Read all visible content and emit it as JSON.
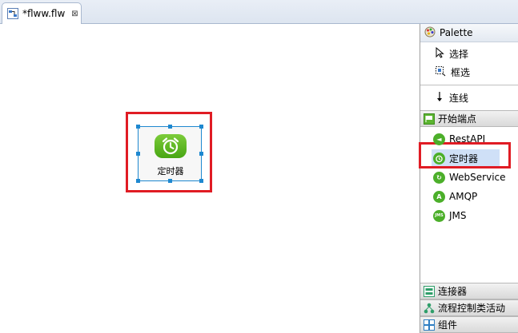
{
  "editor_tab": {
    "label": "*flww.flw",
    "close_glyph": "⊠"
  },
  "node": {
    "label": "定时器",
    "icon": "alarm-clock-icon"
  },
  "palette": {
    "title": "Palette",
    "tools": [
      {
        "label": "选择",
        "icon": "select-arrow-icon"
      },
      {
        "label": "框选",
        "icon": "marquee-icon"
      },
      {
        "label": "连线",
        "icon": "connection-arrow-icon"
      }
    ],
    "start_drawer": {
      "label": "开始端点",
      "entries": [
        {
          "label": "RestAPI",
          "icon": "restapi-icon",
          "glyph": "◄"
        },
        {
          "label": "定时器",
          "icon": "timer-icon",
          "glyph": "⏰",
          "selected": true
        },
        {
          "label": "WebService",
          "icon": "webservice-icon",
          "glyph": "↻"
        },
        {
          "label": "AMQP",
          "icon": "amqp-icon",
          "glyph": "A"
        },
        {
          "label": "JMS",
          "icon": "jms-icon",
          "glyph": "JMS"
        }
      ]
    },
    "bottom_drawers": [
      {
        "label": "连接器",
        "icon": "connector-icon"
      },
      {
        "label": "流程控制类活动",
        "icon": "flow-control-icon"
      },
      {
        "label": "组件",
        "icon": "component-icon"
      }
    ]
  },
  "colors": {
    "highlight_red": "#e01c24",
    "selection_blue": "#1e88d0",
    "green": "#4caf2a"
  }
}
